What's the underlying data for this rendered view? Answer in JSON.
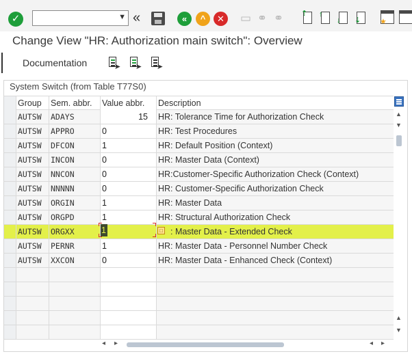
{
  "toolbar": {
    "command_field_value": "",
    "icons": [
      "enter-icon",
      "dropdown-icon",
      "collapse-icon",
      "save-icon",
      "back-icon",
      "exit-icon",
      "cancel-icon",
      "print-icon",
      "find-icon",
      "find-next-icon",
      "first-page-icon",
      "previous-page-icon",
      "next-page-icon",
      "last-page-icon",
      "layout-icon",
      "customize-layout-icon"
    ]
  },
  "page": {
    "title": "Change View \"HR: Authorization main switch\": Overview"
  },
  "app_toolbar": {
    "documentation_label": "Documentation"
  },
  "table": {
    "caption": "System Switch (from Table T77S0)",
    "headers": {
      "group": "Group",
      "sem_abbr": "Sem. abbr.",
      "value_abbr": "Value abbr.",
      "description": "Description"
    },
    "rows": [
      {
        "group": "AUTSW",
        "sem": "ADAYS",
        "value": "15",
        "desc": "HR: Tolerance Time for Authorization Check"
      },
      {
        "group": "AUTSW",
        "sem": "APPRO",
        "value": "0",
        "desc": "HR: Test Procedures"
      },
      {
        "group": "AUTSW",
        "sem": "DFCON",
        "value": "1",
        "desc": "HR: Default Position (Context)"
      },
      {
        "group": "AUTSW",
        "sem": "INCON",
        "value": "0",
        "desc": "HR: Master Data (Context)"
      },
      {
        "group": "AUTSW",
        "sem": "NNCON",
        "value": "0",
        "desc": "HR:Customer-Specific Authorization Check (Context)"
      },
      {
        "group": "AUTSW",
        "sem": "NNNNN",
        "value": "0",
        "desc": "HR: Customer-Specific Authorization Check"
      },
      {
        "group": "AUTSW",
        "sem": "ORGIN",
        "value": "1",
        "desc": "HR: Master Data"
      },
      {
        "group": "AUTSW",
        "sem": "ORGPD",
        "value": "1",
        "desc": "HR: Structural Authorization Check"
      },
      {
        "group": "AUTSW",
        "sem": "ORGXX",
        "value": "1",
        "desc": ": Master Data - Extended Check"
      },
      {
        "group": "AUTSW",
        "sem": "PERNR",
        "value": "1",
        "desc": "HR: Master Data - Personnel Number Check"
      },
      {
        "group": "AUTSW",
        "sem": "XXCON",
        "value": "0",
        "desc": "HR: Master Data - Enhanced Check (Context)"
      }
    ],
    "highlight_color": "#e3f04a"
  },
  "colors": {
    "accent_green": "#1e9e3a",
    "accent_orange": "#f0a31a",
    "accent_red": "#d82a2a"
  }
}
